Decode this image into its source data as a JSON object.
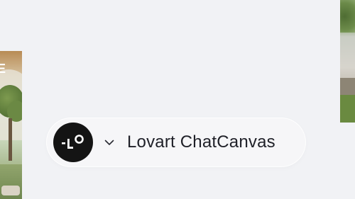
{
  "canvas": {
    "background": "#f1f2f5"
  },
  "thumbnails": {
    "left": {
      "banner_text": "E"
    },
    "right": {}
  },
  "workspace_selector": {
    "logo_icon": "lovart-logo-icon",
    "dropdown_icon": "chevron-down-icon",
    "name": "Lovart ChatCanvas",
    "logo_color": "#141414",
    "text_color": "#1f2028"
  }
}
